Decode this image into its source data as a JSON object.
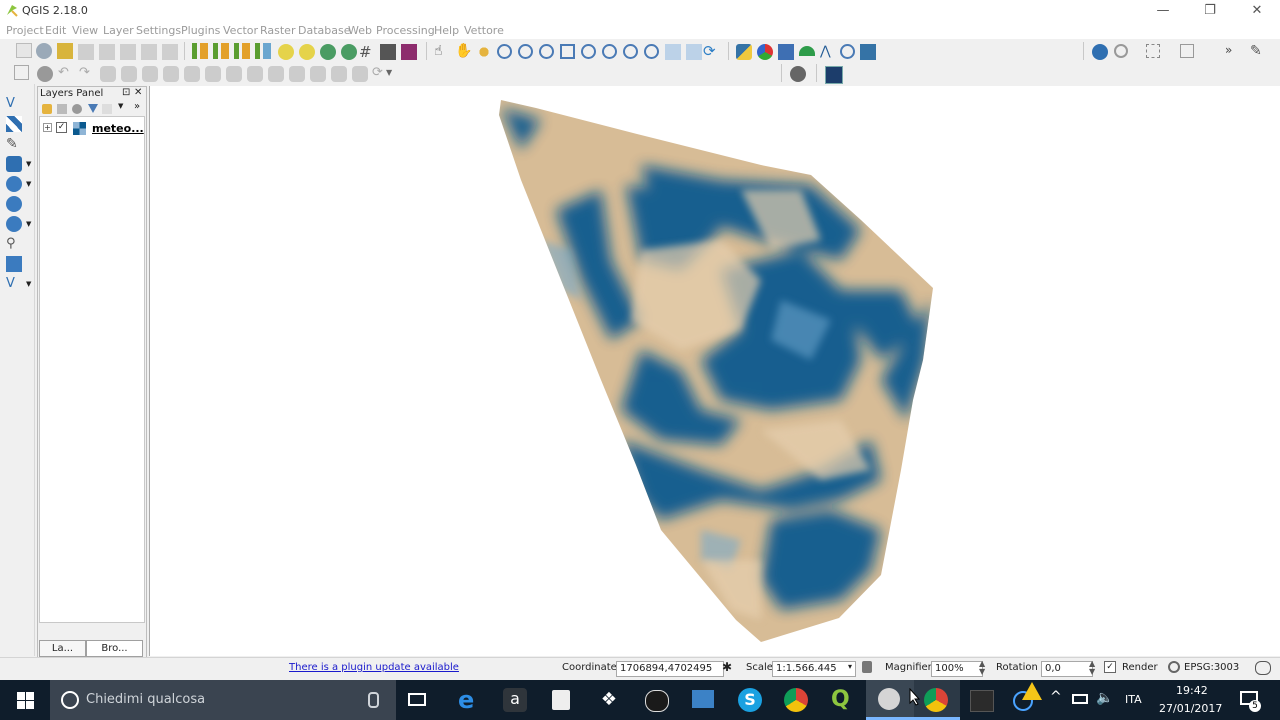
{
  "window": {
    "title": "QGIS 2.18.0",
    "min_glyph": "—",
    "max_glyph": "❐",
    "close_glyph": "✕"
  },
  "menubar": {
    "items": [
      "Project",
      "Edit",
      "View",
      "Layer",
      "Settings",
      "Plugins",
      "Vector",
      "Raster",
      "Database",
      "Web",
      "Processing",
      "Help",
      "Vettore"
    ]
  },
  "layers_panel": {
    "title": "Layers Panel",
    "float_glyph": "⊡",
    "close_glyph": "✕",
    "layer": {
      "name": "meteo...",
      "checked": true,
      "expand": "+"
    },
    "tabs": [
      "La...",
      "Bro..."
    ]
  },
  "statusbar": {
    "plugin_update": "There is a plugin update available",
    "coordinate_label": "Coordinate",
    "coordinate_value": "1706894,4702495",
    "scale_label": "Scale",
    "scale_value": "1:1.566.445",
    "magnifier_label": "Magnifier",
    "magnifier_value": "100%",
    "rotation_label": "Rotation",
    "rotation_value": "0,0",
    "render_label": "Render",
    "render_checked": true,
    "crs": "EPSG:3003"
  },
  "taskbar": {
    "search_placeholder": "Chiedimi qualcosa",
    "lang": "ITA",
    "time": "19:42",
    "date": "27/01/2017",
    "notifications": "5"
  },
  "colors": {
    "accent_blue": "#0b5a8f",
    "sand": "#d9bf98",
    "taskbar": "#0f1d2b",
    "link": "#1a1acc"
  }
}
